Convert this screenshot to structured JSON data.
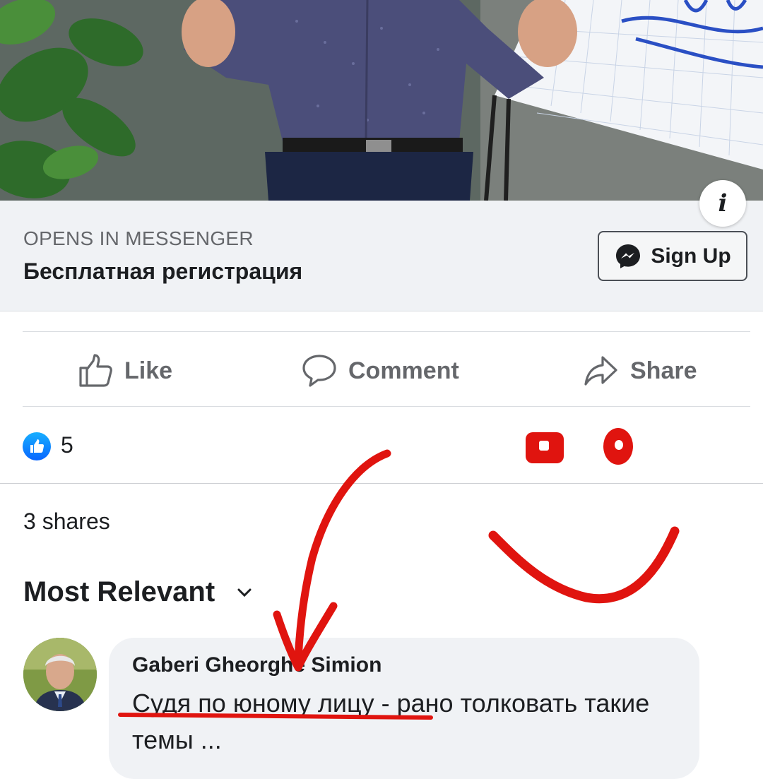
{
  "ad": {
    "cta_caption": "OPENS IN MESSENGER",
    "headline": "Бесплатная регистрация",
    "signup_label": "Sign Up"
  },
  "actions": {
    "like": "Like",
    "comment": "Comment",
    "share": "Share"
  },
  "reactions": {
    "like_count": "5",
    "shares": "3 shares"
  },
  "comments": {
    "sort_label": "Most Relevant",
    "items": [
      {
        "author": "Gaberi Gheorghe Simion",
        "text_underlined": "Судя по юному  лицу",
        "text_rest": " - рано толковать такие темы ..."
      }
    ]
  },
  "colors": {
    "link_blue": "#0866ff",
    "secondary_text": "#65676b",
    "annotation_red": "#e0140f"
  },
  "icons": [
    "info-icon",
    "messenger-icon",
    "like-icon",
    "comment-icon",
    "share-icon",
    "chevron-down-icon"
  ]
}
